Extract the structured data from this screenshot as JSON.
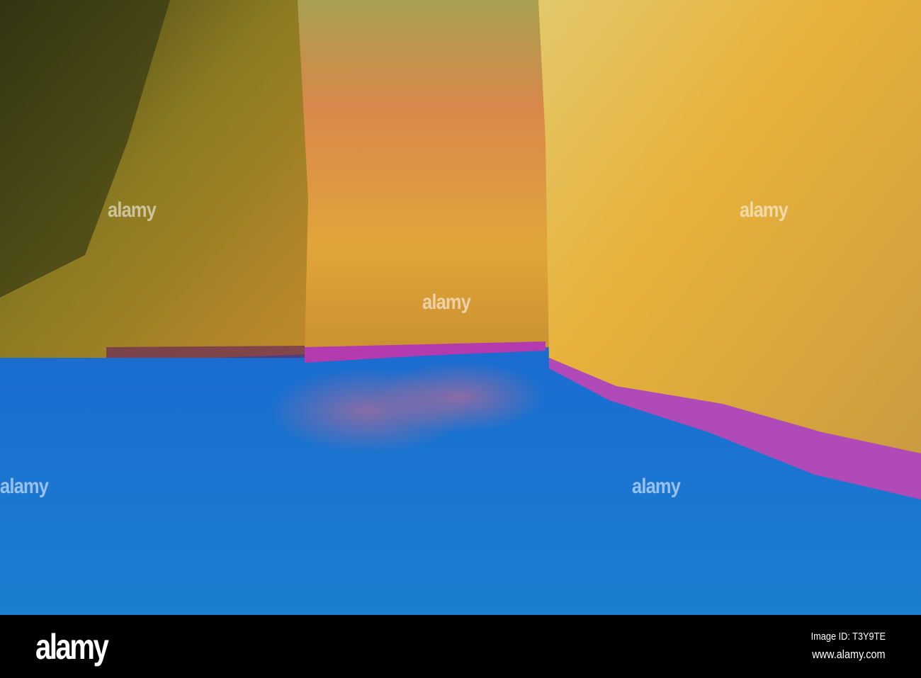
{
  "image": {
    "subject": "Sea cave with ochre rock walls, purple algae waterline and blue water",
    "watermark_text": "alamy"
  },
  "footer": {
    "logo": "alamy",
    "image_id": "Image ID: T3Y9TE",
    "website": "www.alamy.com"
  },
  "colors": {
    "water": "#1a5fc8",
    "rock": "#d6a23a",
    "algae": "#b04ab8",
    "footer_bg": "#000000"
  }
}
